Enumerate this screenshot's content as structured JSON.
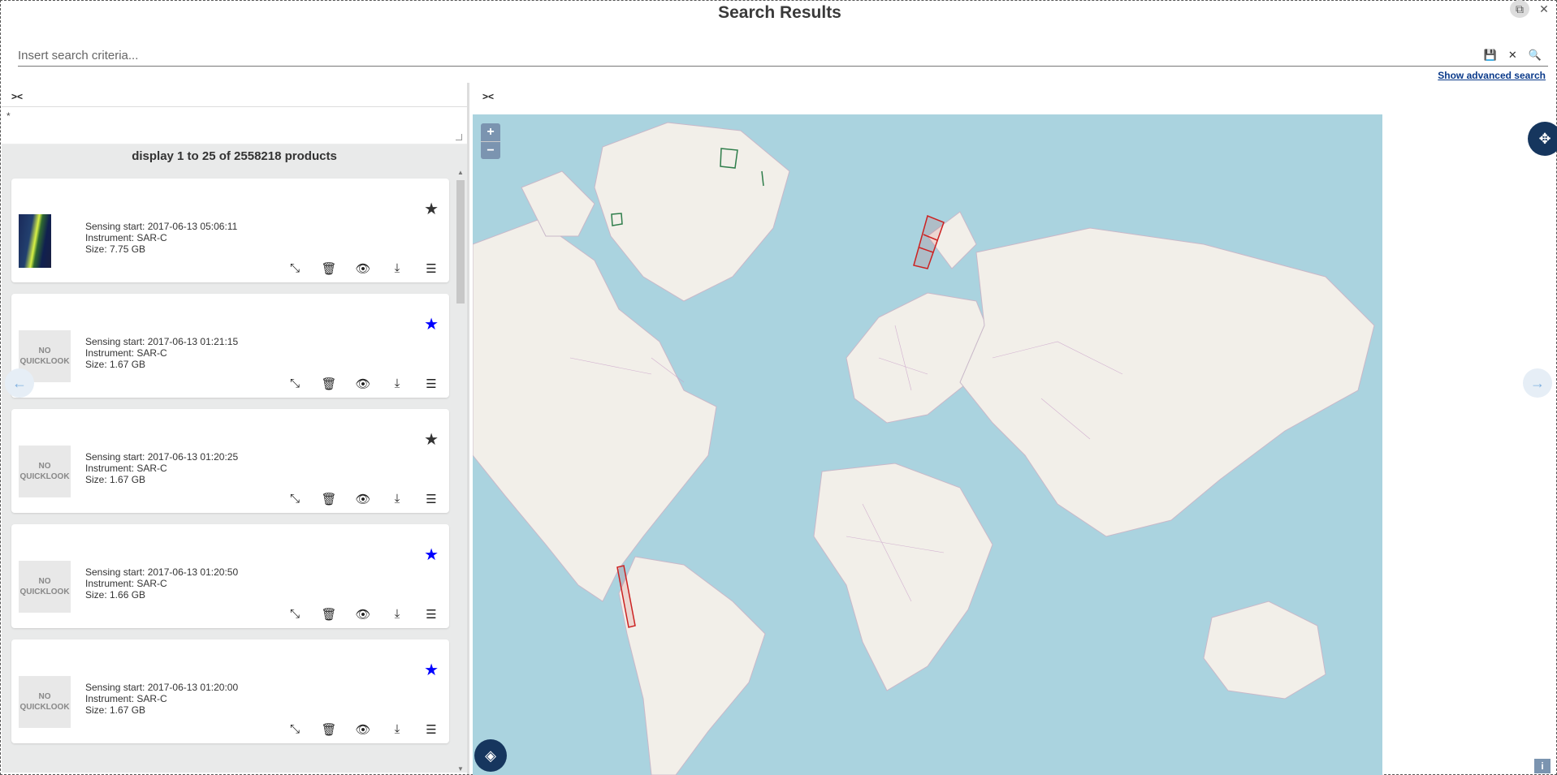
{
  "window": {
    "title": "Search Results",
    "copy_icon": "copy-icon",
    "close_icon": "close-icon"
  },
  "search": {
    "placeholder": "Insert search criteria...",
    "value": "",
    "save_icon": "save-icon",
    "clear_icon": "clear-icon",
    "search_icon": "search-icon",
    "advanced_link": "Show advanced search"
  },
  "list_panel": {
    "collapse_label": "><",
    "filter_value": "*",
    "results_text": "display 1 to 25 of 2558218 products"
  },
  "map_panel": {
    "collapse_label": "><",
    "zoom_in": "+",
    "zoom_out": "−",
    "info": "i"
  },
  "products": [
    {
      "quicklook": "image",
      "quicklook_text": "",
      "sensing": "Sensing start: 2017-06-13 05:06:11",
      "instrument": "Instrument: SAR-C",
      "size": "Size: 7.75 GB",
      "favorite": false
    },
    {
      "quicklook": "none",
      "quicklook_text": "NO QUICKLOOK",
      "sensing": "Sensing start: 2017-06-13 01:21:15",
      "instrument": "Instrument: SAR-C",
      "size": "Size: 1.67 GB",
      "favorite": true
    },
    {
      "quicklook": "none",
      "quicklook_text": "NO QUICKLOOK",
      "sensing": "Sensing start: 2017-06-13 01:20:25",
      "instrument": "Instrument: SAR-C",
      "size": "Size: 1.67 GB",
      "favorite": false
    },
    {
      "quicklook": "none",
      "quicklook_text": "NO QUICKLOOK",
      "sensing": "Sensing start: 2017-06-13 01:20:50",
      "instrument": "Instrument: SAR-C",
      "size": "Size: 1.66 GB",
      "favorite": true
    },
    {
      "quicklook": "none",
      "quicklook_text": "NO QUICKLOOK",
      "sensing": "Sensing start: 2017-06-13 01:20:00",
      "instrument": "Instrument: SAR-C",
      "size": "Size: 1.67 GB",
      "favorite": true
    }
  ],
  "colors": {
    "favorite": "#0000ff",
    "footprint_selected": "#cc2222",
    "footprint_other": "#2e7d4a",
    "map_water": "#aad3df",
    "map_land": "#f2efe9",
    "nav_dark": "#16365e"
  }
}
